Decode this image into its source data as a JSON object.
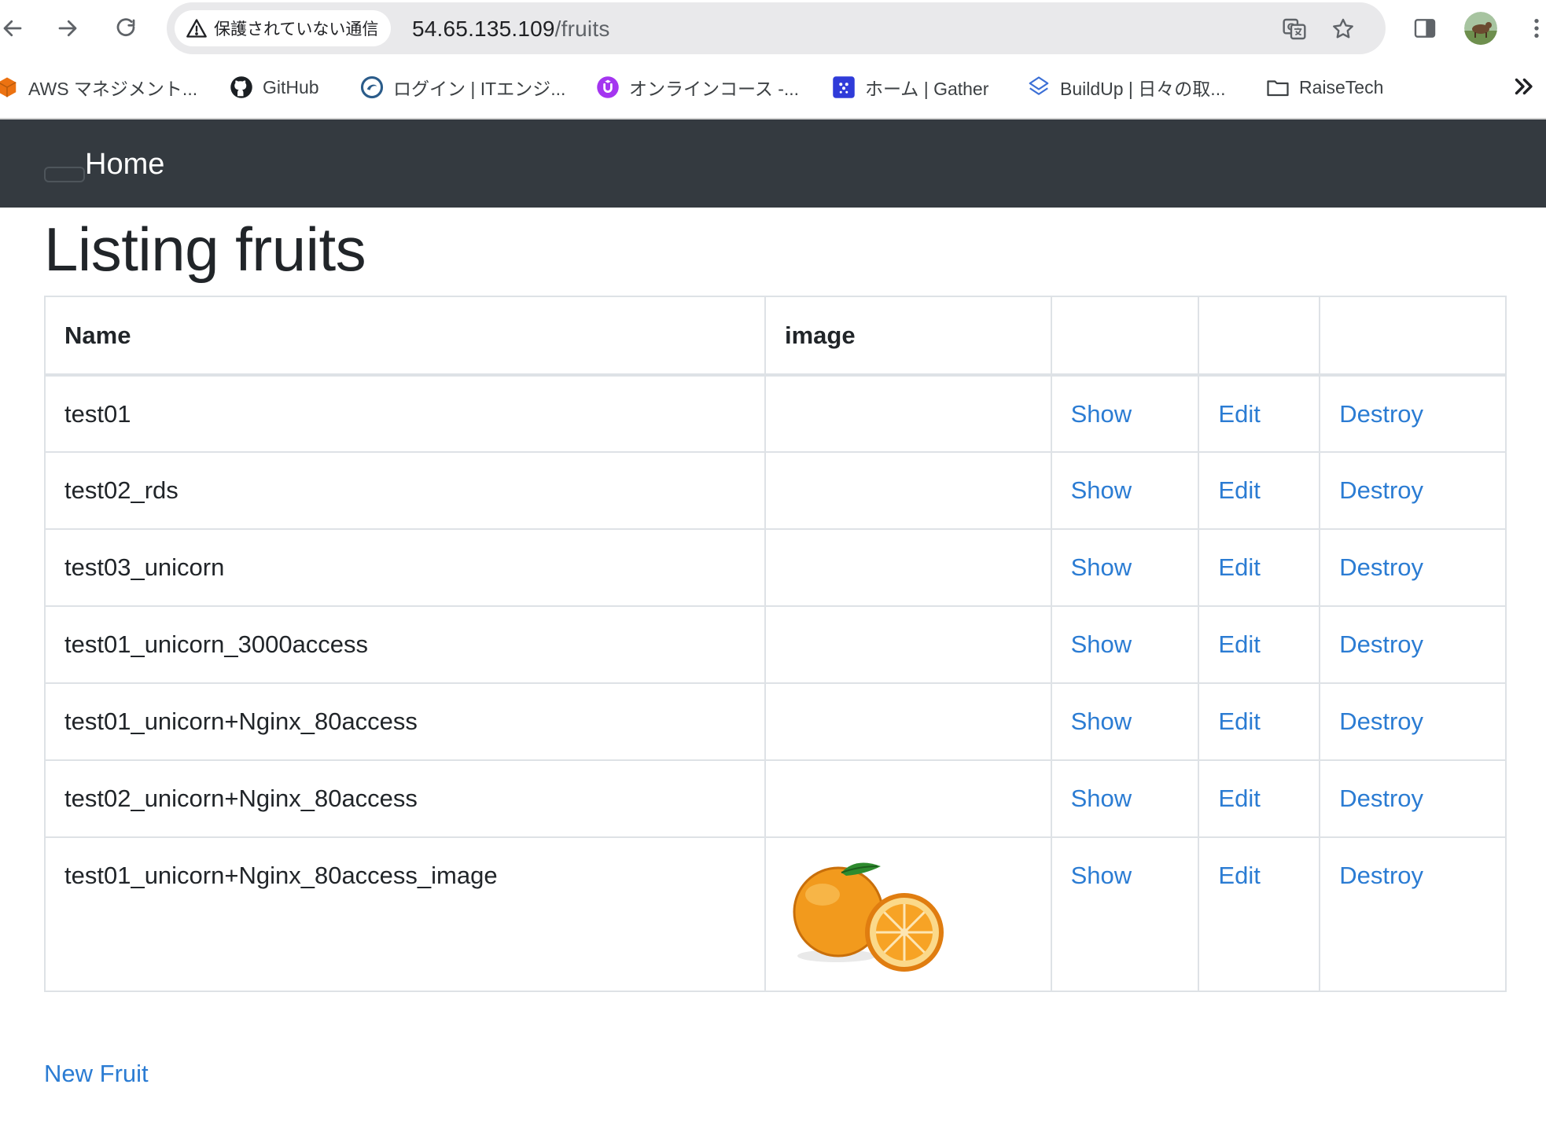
{
  "browser": {
    "security_label": "保護されていない通信",
    "url_host": "54.65.135.109",
    "url_path": "/fruits",
    "bookmarks": [
      {
        "label": "AWS マネジメント..."
      },
      {
        "label": "GitHub"
      },
      {
        "label": "ログイン | ITエンジ..."
      },
      {
        "label": "オンラインコース -..."
      },
      {
        "label": "ホーム | Gather"
      },
      {
        "label": "BuildUp | 日々の取..."
      },
      {
        "label": "RaiseTech"
      }
    ],
    "more_label": "»"
  },
  "navbar": {
    "brand": "Home"
  },
  "page": {
    "title": "Listing fruits",
    "table": {
      "headers": [
        "Name",
        "image",
        "",
        "",
        ""
      ],
      "rows": [
        {
          "name": "test01",
          "show": "Show",
          "edit": "Edit",
          "destroy": "Destroy"
        },
        {
          "name": "test02_rds",
          "show": "Show",
          "edit": "Edit",
          "destroy": "Destroy"
        },
        {
          "name": "test03_unicorn",
          "show": "Show",
          "edit": "Edit",
          "destroy": "Destroy"
        },
        {
          "name": "test01_unicorn_3000access",
          "show": "Show",
          "edit": "Edit",
          "destroy": "Destroy"
        },
        {
          "name": "test01_unicorn+Nginx_80access",
          "show": "Show",
          "edit": "Edit",
          "destroy": "Destroy"
        },
        {
          "name": "test02_unicorn+Nginx_80access",
          "show": "Show",
          "edit": "Edit",
          "destroy": "Destroy"
        },
        {
          "name": "test01_unicorn+Nginx_80access_image",
          "show": "Show",
          "edit": "Edit",
          "destroy": "Destroy"
        }
      ]
    },
    "new_link": "New Fruit"
  },
  "colors": {
    "navbar_bg": "#343a40",
    "link": "#2b7cd3",
    "table_border": "#dee2e6"
  }
}
